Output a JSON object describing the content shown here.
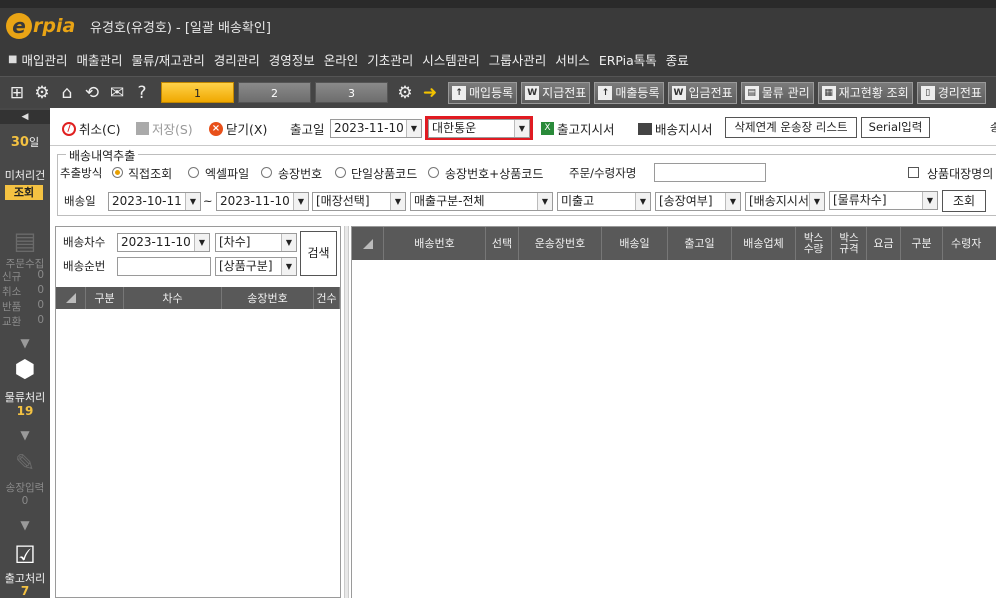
{
  "app": {
    "logo_text": "rpia",
    "title": "유경호(유경호) - [일괄 배송확인]"
  },
  "menu": {
    "items": [
      "매입관리",
      "매출관리",
      "물류/재고관리",
      "경리관리",
      "경영정보",
      "온라인",
      "기초관리",
      "시스템관리",
      "그룹사관리",
      "서비스",
      "ERPia톡톡",
      "종료"
    ]
  },
  "toolbar": {
    "tabs": [
      "1",
      "2",
      "3"
    ],
    "quick_buttons": [
      {
        "label": "매입등록",
        "icon": "upload-icon"
      },
      {
        "label": "지급전표",
        "icon": "doc-w-icon"
      },
      {
        "label": "매출등록",
        "icon": "upload-icon"
      },
      {
        "label": "입금전표",
        "icon": "doc-w-icon"
      },
      {
        "label": "물류 관리",
        "icon": "printer-icon"
      },
      {
        "label": "재고현황 조회",
        "icon": "stock-icon"
      },
      {
        "label": "경리전표",
        "icon": "doc-icon"
      }
    ]
  },
  "sidebar": {
    "days": "30",
    "days_unit": "일",
    "unprocessed_label": "미처리건",
    "inquiry_button": "조회",
    "order_collect": {
      "title": "주문수집",
      "rows": [
        {
          "label": "신규",
          "count": "0"
        },
        {
          "label": "취소",
          "count": "0"
        },
        {
          "label": "반품",
          "count": "0"
        },
        {
          "label": "교환",
          "count": "0"
        }
      ]
    },
    "logistics": {
      "label": "물류처리",
      "count": "19"
    },
    "invoice": {
      "label": "송장입력",
      "count": "0"
    },
    "shipping": {
      "label": "출고처리",
      "count": "7"
    }
  },
  "actionbar": {
    "cancel": "취소(C)",
    "save": "저장(S)",
    "close": "닫기(X)",
    "ship_date_label": "출고일",
    "ship_date_value": "2023-11-10",
    "carrier_value": "대한통운",
    "ship_instruction": "출고지시서",
    "delivery_instruction": "배송지시서",
    "delete_link_button": "삭제연계 운송장 리스트",
    "serial_button": "Serial입력",
    "cut_char": "송",
    "highlight_color": "#e01b22"
  },
  "extract": {
    "legend": "배송내역추출",
    "method_label": "추출방식",
    "methods": [
      {
        "label": "직접조회",
        "selected": true
      },
      {
        "label": "엑셀파일",
        "selected": false
      },
      {
        "label": "송장번호",
        "selected": false
      },
      {
        "label": "단일상품코드",
        "selected": false
      },
      {
        "label": "송장번호+상품코드",
        "selected": false
      }
    ],
    "orderer_label": "주문/수령자명",
    "orderer_value": "",
    "product_name_check_label": "상품대장명의",
    "delivery_date_label": "배송일",
    "date_from": "2023-10-11",
    "date_sep": "~",
    "date_to": "2023-11-10",
    "store_select": "[매장선택]",
    "sales_select": "매출구분-전체",
    "status_select": "미출고",
    "invoice_select": "[송장여부]",
    "delivery_instr_select": "[배송지시서]",
    "logistics_select": "[물류차수]",
    "search_button": "조회"
  },
  "leftpanel": {
    "batch_label": "배송차수",
    "batch_date": "2023-11-10",
    "batch_select": "[차수]",
    "order_label": "배송순번",
    "order_value": "",
    "product_select": "[상품구분]",
    "search_button": "검색",
    "columns": [
      "구분",
      "차수",
      "송장번호",
      "건수"
    ]
  },
  "rightpanel": {
    "columns": [
      "배송번호",
      "선택",
      "운송장번호",
      "배송일",
      "출고일",
      "배송업체",
      "박스\n수량",
      "박스\n규격",
      "요금",
      "구분",
      "수령자"
    ]
  }
}
